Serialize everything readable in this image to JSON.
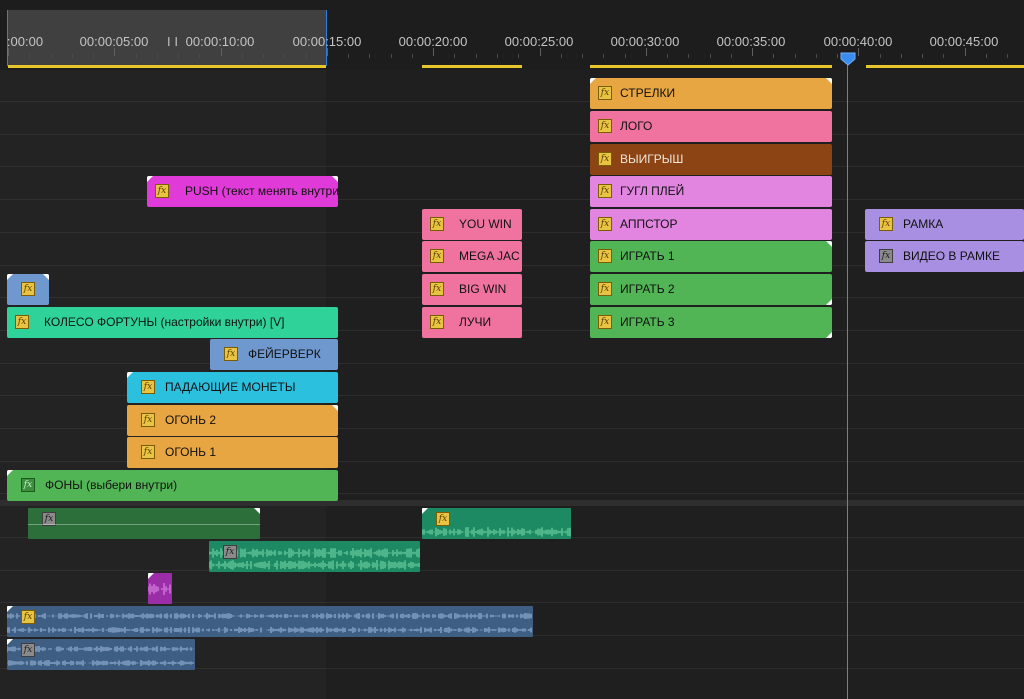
{
  "ruler": {
    "timecodes": [
      ":00:00",
      "00:00:05:00",
      "00:00:10:00",
      "00:00:15:00",
      "00:00:20:00",
      "00:00:25:00",
      "00:00:30:00",
      "00:00:35:00",
      "00:00:40:00",
      "00:00:45:00"
    ]
  },
  "colors": {
    "playhead": "#3b8ded",
    "work_area": "#e6c62a"
  },
  "video_clips": [
    {
      "label": "СТРЕЛКИ",
      "fx": "fx",
      "color": "#e8a643",
      "fx_style": "yellow"
    },
    {
      "label": "ЛОГО",
      "fx": "fx",
      "color": "#f0739f",
      "fx_style": "yellow"
    },
    {
      "label": "ВЫИГРЫШ",
      "fx": "fx",
      "color": "#8c4414",
      "fx_style": "yellow"
    },
    {
      "label": "PUSH (текст менять внутри",
      "fx": "fx",
      "color": "#e03ad8",
      "fx_style": "yellow"
    },
    {
      "label": "ГУГЛ ПЛЕЙ",
      "fx": "fx",
      "color": "#e185e1",
      "fx_style": "yellow"
    },
    {
      "label": "YOU WIN",
      "fx": "fx",
      "color": "#f0739f",
      "fx_style": "yellow"
    },
    {
      "label": "АППСТОР",
      "fx": "fx",
      "color": "#e185e1",
      "fx_style": "yellow"
    },
    {
      "label": "РАМКА",
      "fx": "fx",
      "color": "#a88fe1",
      "fx_style": "yellow"
    },
    {
      "label": "MEGA JAC",
      "fx": "fx",
      "color": "#f0739f",
      "fx_style": "yellow"
    },
    {
      "label": "ИГРАТЬ 1",
      "fx": "fx",
      "color": "#52b555",
      "fx_style": "yellow"
    },
    {
      "label": "ВИДЕО В РАМКЕ",
      "fx": "fx",
      "color": "#a88fe1",
      "fx_style": "gray"
    },
    {
      "label": "",
      "fx": "fx",
      "color": "#6f98cf",
      "fx_style": "yellow"
    },
    {
      "label": "BIG WIN",
      "fx": "fx",
      "color": "#f0739f",
      "fx_style": "yellow"
    },
    {
      "label": "ИГРАТЬ 2",
      "fx": "fx",
      "color": "#52b555",
      "fx_style": "yellow"
    },
    {
      "label": "КОЛЕСО ФОРТУНЫ (настройки внутри) [V]",
      "fx": "fx",
      "color": "#2fd39a",
      "fx_style": "yellow"
    },
    {
      "label": "ЛУЧИ",
      "fx": "fx",
      "color": "#f0739f",
      "fx_style": "yellow"
    },
    {
      "label": "ИГРАТЬ 3",
      "fx": "fx",
      "color": "#52b555",
      "fx_style": "yellow"
    },
    {
      "label": "ФЕЙЕРВЕРК",
      "fx": "fx",
      "color": "#6f98cf",
      "fx_style": "yellow"
    },
    {
      "label": "ПАДАЮЩИЕ МОНЕТЫ",
      "fx": "fx",
      "color": "#2cc0df",
      "fx_style": "yellow"
    },
    {
      "label": "ОГОНЬ 2",
      "fx": "fx",
      "color": "#e8a643",
      "fx_style": "yellow"
    },
    {
      "label": "ОГОНЬ 1",
      "fx": "fx",
      "color": "#e8a643",
      "fx_style": "yellow"
    },
    {
      "label": "ФОНЫ (выбери внутри)",
      "fx": "fx",
      "color": "#52b555",
      "fx_style": "green"
    }
  ],
  "audio_clips": [
    {
      "fx": "fx",
      "color": "#2d6f3a",
      "fx_style": "gray"
    },
    {
      "fx": "fx",
      "color": "#1e8a63",
      "fx_style": "yellow"
    },
    {
      "fx": "fx",
      "color": "#1e8a63",
      "fx_style": "gray"
    },
    {
      "fx": "",
      "color": "#9c2da8",
      "fx_style": "none"
    },
    {
      "fx": "fx",
      "color": "#3e5e83",
      "fx_style": "yellow"
    },
    {
      "fx": "fx",
      "color": "#3e5e83",
      "fx_style": "gray"
    }
  ]
}
